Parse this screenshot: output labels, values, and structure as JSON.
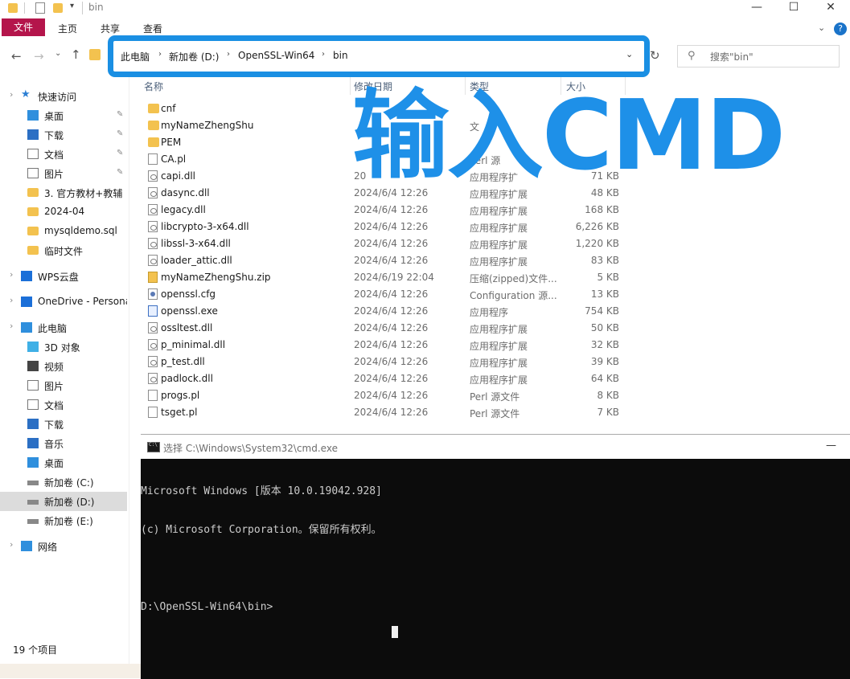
{
  "window": {
    "title": "bin",
    "controls": {
      "minimize": "—",
      "maximize": "☐",
      "close": "✕"
    }
  },
  "ribbon": {
    "tabs": [
      {
        "label": "文件"
      },
      {
        "label": "主页"
      },
      {
        "label": "共享"
      },
      {
        "label": "查看"
      }
    ],
    "help": "?"
  },
  "address": {
    "crumbs": [
      "此电脑",
      "新加卷 (D:)",
      "OpenSSL-Win64",
      "bin"
    ],
    "search_placeholder": "搜索\"bin\""
  },
  "overlay_text": "输入CMD",
  "sidebar": {
    "items": [
      {
        "label": "快速访问",
        "icon": "star-icon",
        "level": 0,
        "pinned": false
      },
      {
        "label": "桌面",
        "icon": "desktop-icon",
        "level": 1,
        "pinned": true
      },
      {
        "label": "下载",
        "icon": "download-icon",
        "level": 1,
        "pinned": true
      },
      {
        "label": "文档",
        "icon": "document-icon",
        "level": 1,
        "pinned": true
      },
      {
        "label": "图片",
        "icon": "picture-icon",
        "level": 1,
        "pinned": true
      },
      {
        "label": "3. 官方教材+教辅",
        "icon": "folder-icon",
        "level": 1,
        "pinned": false
      },
      {
        "label": "2024-04",
        "icon": "folder-icon",
        "level": 1,
        "pinned": false
      },
      {
        "label": "mysqldemo.sql",
        "icon": "folder-icon",
        "level": 1,
        "pinned": false
      },
      {
        "label": "临时文件",
        "icon": "folder-icon",
        "level": 1,
        "pinned": false
      },
      {
        "label": "WPS云盘",
        "icon": "cloud-icon",
        "level": 0,
        "pinned": false
      },
      {
        "label": "OneDrive - Persona",
        "icon": "onedrive-icon",
        "level": 0,
        "pinned": false
      },
      {
        "label": "此电脑",
        "icon": "computer-icon",
        "level": 0,
        "pinned": false
      },
      {
        "label": "3D 对象",
        "icon": "3d-objects-icon",
        "level": 1,
        "pinned": false
      },
      {
        "label": "视频",
        "icon": "video-icon",
        "level": 1,
        "pinned": false
      },
      {
        "label": "图片",
        "icon": "picture-icon",
        "level": 1,
        "pinned": false
      },
      {
        "label": "文档",
        "icon": "document-icon",
        "level": 1,
        "pinned": false
      },
      {
        "label": "下载",
        "icon": "download-icon",
        "level": 1,
        "pinned": false
      },
      {
        "label": "音乐",
        "icon": "music-icon",
        "level": 1,
        "pinned": false
      },
      {
        "label": "桌面",
        "icon": "desktop-icon",
        "level": 1,
        "pinned": false
      },
      {
        "label": "新加卷 (C:)",
        "icon": "drive-icon",
        "level": 1,
        "pinned": false
      },
      {
        "label": "新加卷 (D:)",
        "icon": "drive-icon",
        "level": 1,
        "pinned": false,
        "selected": true
      },
      {
        "label": "新加卷 (E:)",
        "icon": "drive-icon",
        "level": 1,
        "pinned": false
      },
      {
        "label": "网络",
        "icon": "network-icon",
        "level": 0,
        "pinned": false
      }
    ]
  },
  "columns": {
    "name": "名称",
    "modified": "修改日期",
    "type": "类型",
    "size": "大小"
  },
  "files": [
    {
      "name": "cnf",
      "date": "",
      "type": "",
      "size": "",
      "kind": "folder"
    },
    {
      "name": "myNameZhengShu",
      "date": "",
      "type": "文",
      "size": "",
      "kind": "folder"
    },
    {
      "name": "PEM",
      "date": "",
      "type": "",
      "size": "",
      "kind": "folder"
    },
    {
      "name": "CA.pl",
      "date": "",
      "type": "Perl 源",
      "size": "",
      "kind": "file"
    },
    {
      "name": "capi.dll",
      "date": "20",
      "type": "应用程序扩",
      "size": "71 KB",
      "kind": "dll"
    },
    {
      "name": "dasync.dll",
      "date": "2024/6/4 12:26",
      "type": "应用程序扩展",
      "size": "48 KB",
      "kind": "dll"
    },
    {
      "name": "legacy.dll",
      "date": "2024/6/4 12:26",
      "type": "应用程序扩展",
      "size": "168 KB",
      "kind": "dll"
    },
    {
      "name": "libcrypto-3-x64.dll",
      "date": "2024/6/4 12:26",
      "type": "应用程序扩展",
      "size": "6,226 KB",
      "kind": "dll"
    },
    {
      "name": "libssl-3-x64.dll",
      "date": "2024/6/4 12:26",
      "type": "应用程序扩展",
      "size": "1,220 KB",
      "kind": "dll"
    },
    {
      "name": "loader_attic.dll",
      "date": "2024/6/4 12:26",
      "type": "应用程序扩展",
      "size": "83 KB",
      "kind": "dll"
    },
    {
      "name": "myNameZhengShu.zip",
      "date": "2024/6/19 22:04",
      "type": "压缩(zipped)文件...",
      "size": "5 KB",
      "kind": "zip"
    },
    {
      "name": "openssl.cfg",
      "date": "2024/6/4 12:26",
      "type": "Configuration 源...",
      "size": "13 KB",
      "kind": "cfg"
    },
    {
      "name": "openssl.exe",
      "date": "2024/6/4 12:26",
      "type": "应用程序",
      "size": "754 KB",
      "kind": "exe"
    },
    {
      "name": "ossltest.dll",
      "date": "2024/6/4 12:26",
      "type": "应用程序扩展",
      "size": "50 KB",
      "kind": "dll"
    },
    {
      "name": "p_minimal.dll",
      "date": "2024/6/4 12:26",
      "type": "应用程序扩展",
      "size": "32 KB",
      "kind": "dll"
    },
    {
      "name": "p_test.dll",
      "date": "2024/6/4 12:26",
      "type": "应用程序扩展",
      "size": "39 KB",
      "kind": "dll"
    },
    {
      "name": "padlock.dll",
      "date": "2024/6/4 12:26",
      "type": "应用程序扩展",
      "size": "64 KB",
      "kind": "dll"
    },
    {
      "name": "progs.pl",
      "date": "2024/6/4 12:26",
      "type": "Perl 源文件",
      "size": "8 KB",
      "kind": "file"
    },
    {
      "name": "tsget.pl",
      "date": "2024/6/4 12:26",
      "type": "Perl 源文件",
      "size": "7 KB",
      "kind": "file"
    }
  ],
  "status": {
    "count": "19 个项目"
  },
  "cmd": {
    "title": "选择 C:\\Windows\\System32\\cmd.exe",
    "lines": [
      "Microsoft Windows [版本 10.0.19042.928]",
      "(c) Microsoft Corporation。保留所有权利。",
      "",
      "D:\\OpenSSL-Win64\\bin>"
    ]
  },
  "colors": {
    "accent": "#1e90e8",
    "file_tab": "#b4154b",
    "folder": "#f3c24f",
    "console_bg": "#0c0c0c"
  }
}
